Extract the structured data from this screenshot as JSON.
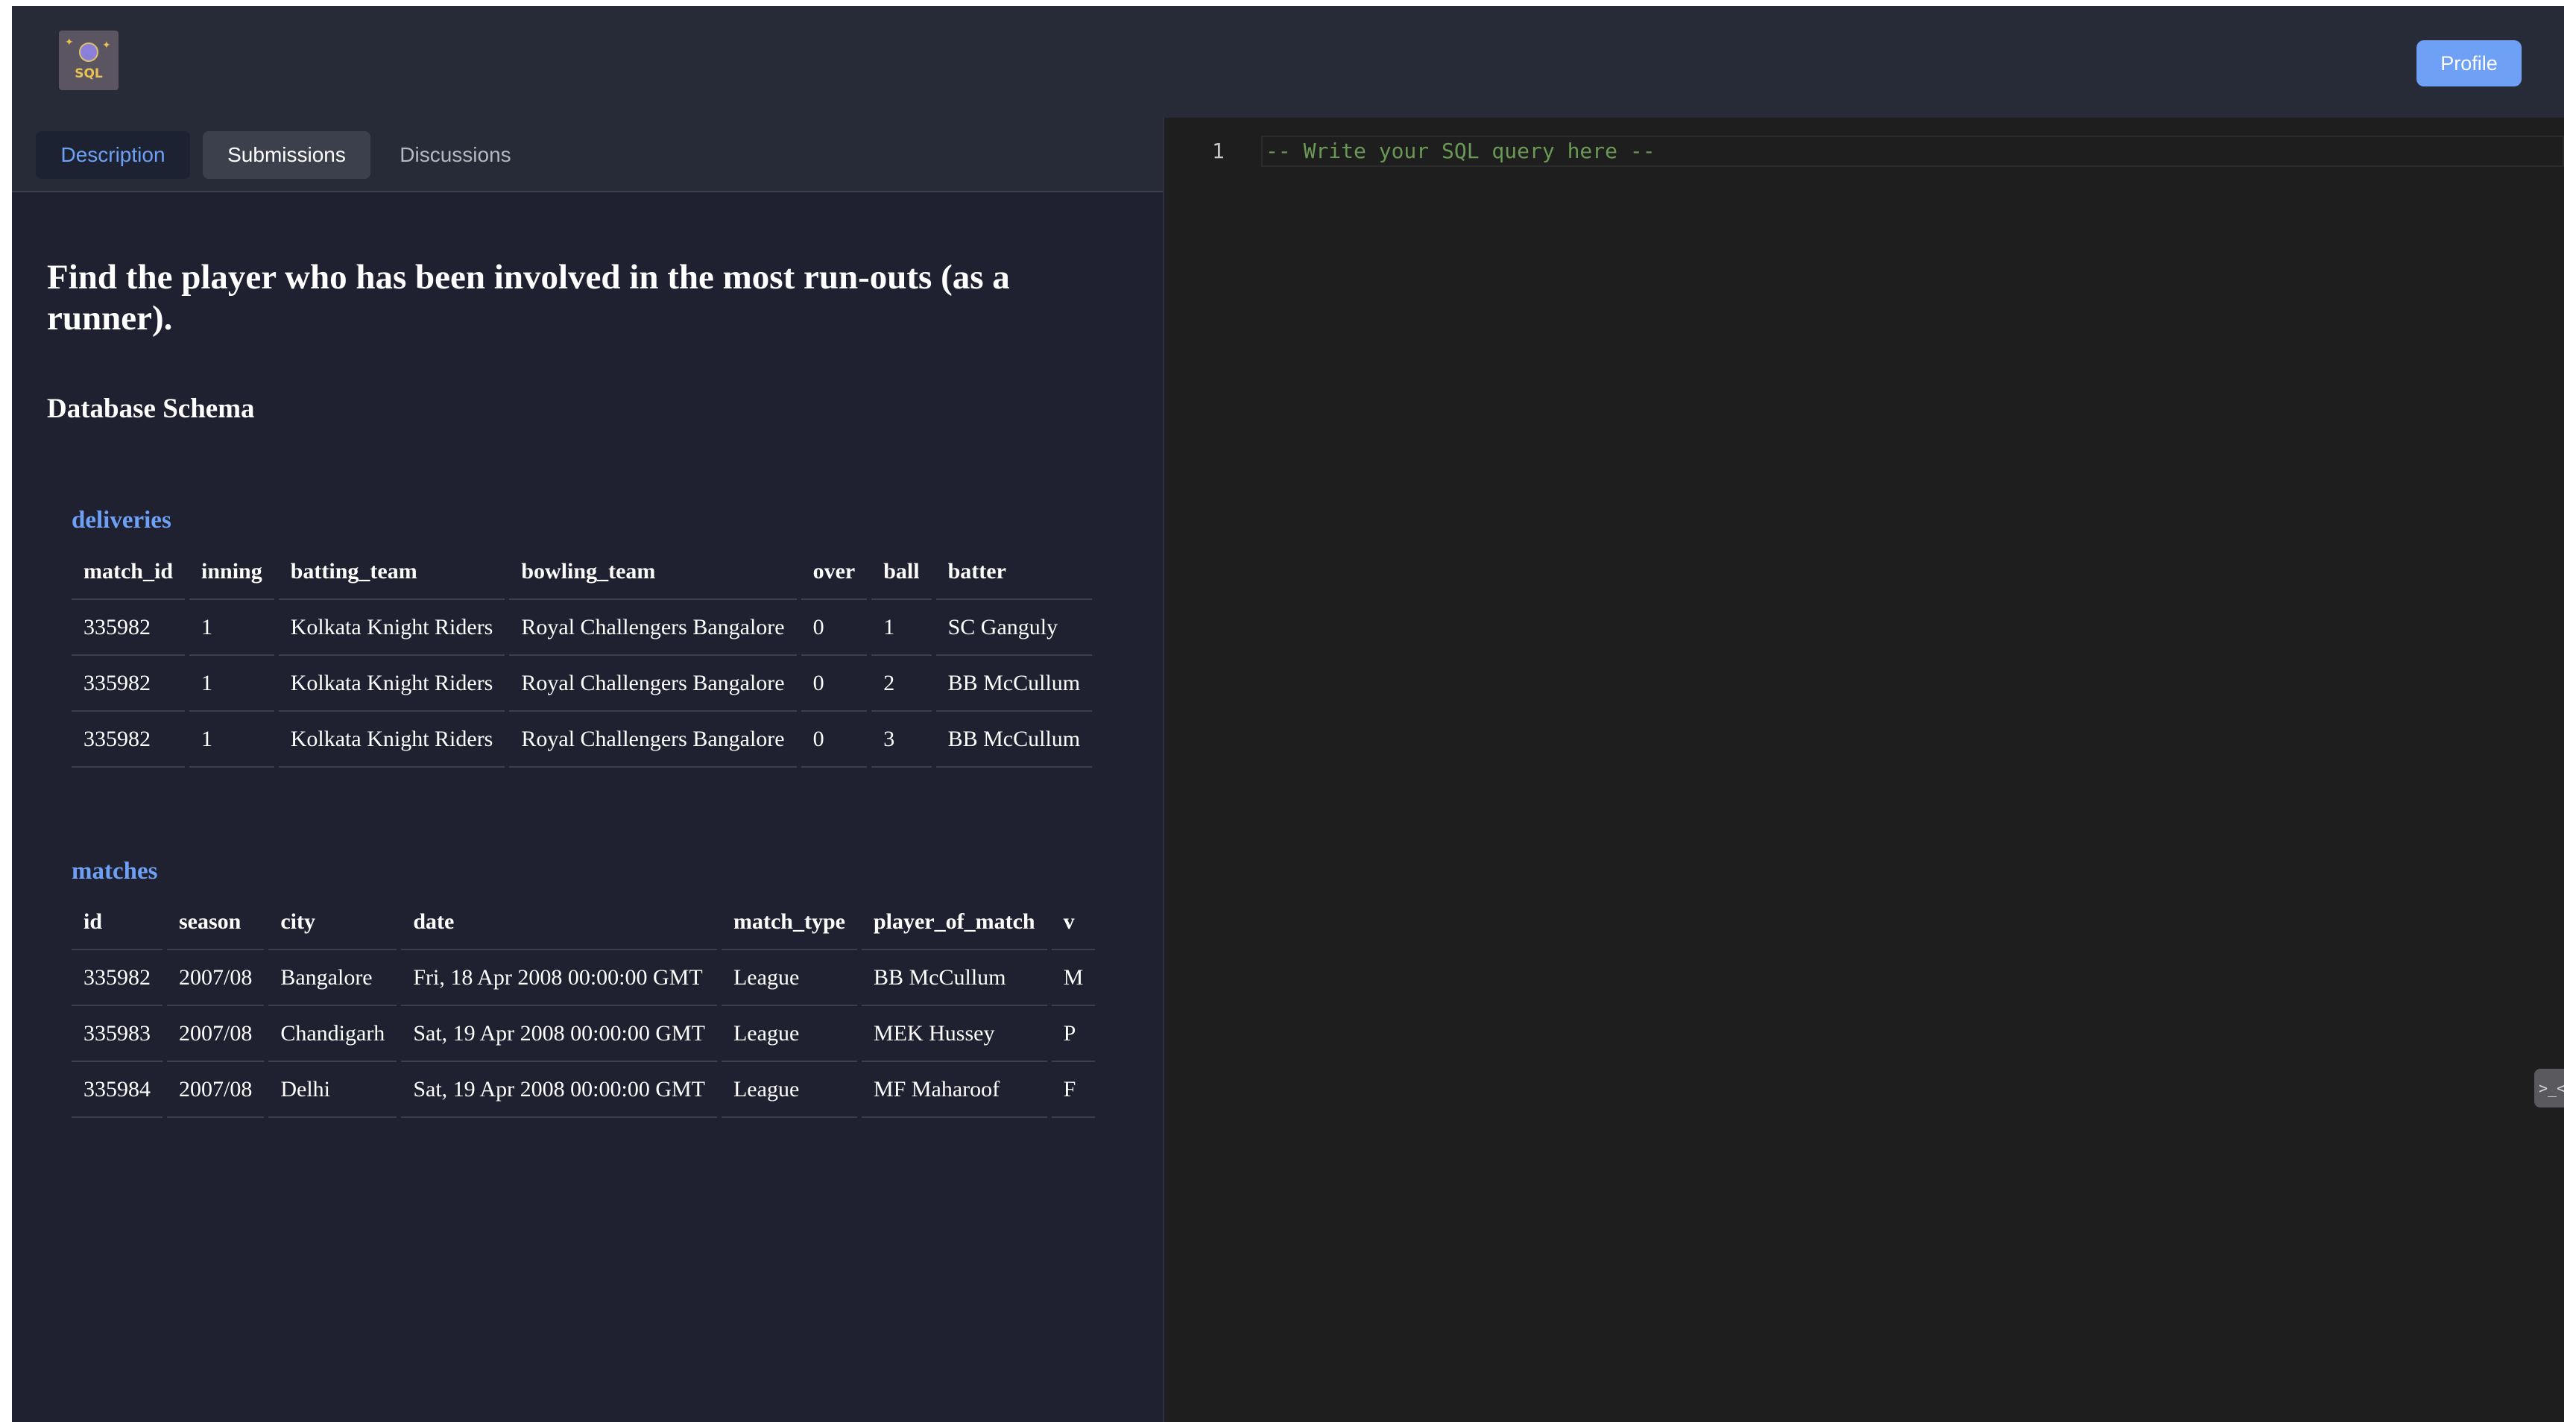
{
  "header": {
    "logo_text": "SQL",
    "profile_label": "Profile"
  },
  "tabs": {
    "description": "Description",
    "submissions": "Submissions",
    "discussions": "Discussions",
    "active": "Description"
  },
  "problem": {
    "question": "Find the player who has been involved in the most run-outs (as a runner).",
    "schema_heading": "Database Schema"
  },
  "tables": {
    "deliveries": {
      "title": "deliveries",
      "columns": [
        "match_id",
        "inning",
        "batting_team",
        "bowling_team",
        "over",
        "ball",
        "batter"
      ],
      "rows": [
        [
          "335982",
          "1",
          "Kolkata Knight Riders",
          "Royal Challengers Bangalore",
          "0",
          "1",
          "SC Ganguly"
        ],
        [
          "335982",
          "1",
          "Kolkata Knight Riders",
          "Royal Challengers Bangalore",
          "0",
          "2",
          "BB McCullum"
        ],
        [
          "335982",
          "1",
          "Kolkata Knight Riders",
          "Royal Challengers Bangalore",
          "0",
          "3",
          "BB McCullum"
        ]
      ]
    },
    "matches": {
      "title": "matches",
      "columns": [
        "id",
        "season",
        "city",
        "date",
        "match_type",
        "player_of_match",
        "v"
      ],
      "rows": [
        [
          "335982",
          "2007/08",
          "Bangalore",
          "Fri, 18 Apr 2008 00:00:00 GMT",
          "League",
          "BB McCullum",
          "M"
        ],
        [
          "335983",
          "2007/08",
          "Chandigarh",
          "Sat, 19 Apr 2008 00:00:00 GMT",
          "League",
          "MEK Hussey",
          "P"
        ],
        [
          "335984",
          "2007/08",
          "Delhi",
          "Sat, 19 Apr 2008 00:00:00 GMT",
          "League",
          "MF Maharoof",
          "F"
        ]
      ]
    }
  },
  "editor": {
    "line_number": "1",
    "placeholder_line": "-- Write your SQL query here --",
    "handle_glyph": ">_<"
  },
  "colors": {
    "accent": "#6ea1f5",
    "background": "#272a37",
    "panel": "#1f2030",
    "editor_bg": "#1e1e1e",
    "comment": "#6a9955"
  }
}
